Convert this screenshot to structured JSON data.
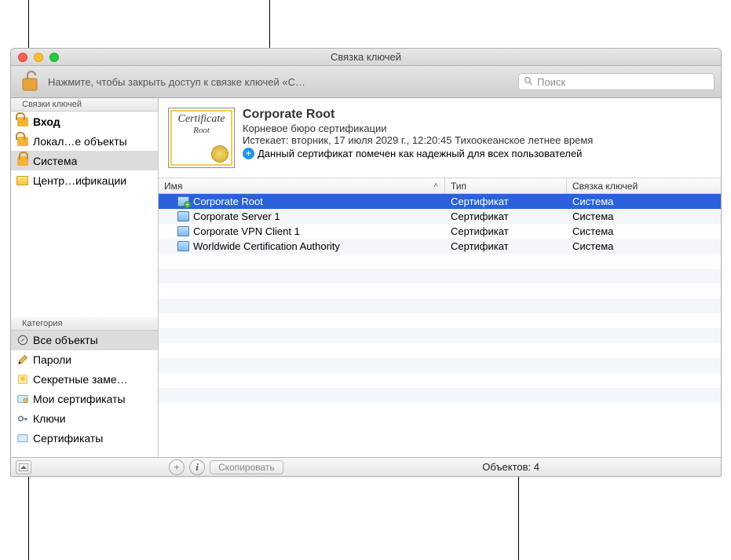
{
  "window": {
    "title": "Связка ключей"
  },
  "toolbar": {
    "status": "Нажмите, чтобы закрыть доступ к связке ключей «С…",
    "search_placeholder": "Поиск"
  },
  "sidebar": {
    "keychains_header": "Связки ключей",
    "keychains": [
      {
        "label": "Вход",
        "icon": "lock-open",
        "bold": true
      },
      {
        "label": "Локал…е объекты",
        "icon": "lock-open"
      },
      {
        "label": "Система",
        "icon": "lock-closed",
        "selected": true
      },
      {
        "label": "Центр…ификации",
        "icon": "folder"
      }
    ],
    "category_header": "Категория",
    "categories": [
      {
        "label": "Все объекты",
        "icon": "compass",
        "selected": true
      },
      {
        "label": "Пароли",
        "icon": "pencil"
      },
      {
        "label": "Секретные заме…",
        "icon": "note"
      },
      {
        "label": "Мои сертификаты",
        "icon": "cert-my"
      },
      {
        "label": "Ключи",
        "icon": "key"
      },
      {
        "label": "Сертификаты",
        "icon": "cert"
      }
    ]
  },
  "detail": {
    "thumb_text": "Certificate",
    "thumb_sub": "Root",
    "name": "Corporate Root",
    "subtitle": "Корневое бюро сертификации",
    "expires": "Истекает: вторник, 17 июля 2029 г., 12:20:45 Тихоокеанское летнее время",
    "trusted": "Данный сертификат помечен как надежный для всех пользователей"
  },
  "columns": {
    "name": "Имя",
    "type": "Тип",
    "keychain": "Связка ключей"
  },
  "rows": [
    {
      "name": "Corporate Root",
      "type": "Сертификат",
      "keychain": "Система",
      "selected": true,
      "plus": true
    },
    {
      "name": "Corporate Server 1",
      "type": "Сертификат",
      "keychain": "Система"
    },
    {
      "name": "Corporate VPN Client 1",
      "type": "Сертификат",
      "keychain": "Система"
    },
    {
      "name": "Worldwide Certification Authority",
      "type": "Сертификат",
      "keychain": "Система"
    }
  ],
  "footer": {
    "copy": "Скопировать",
    "status_prefix": "Объектов:",
    "count": "4"
  }
}
